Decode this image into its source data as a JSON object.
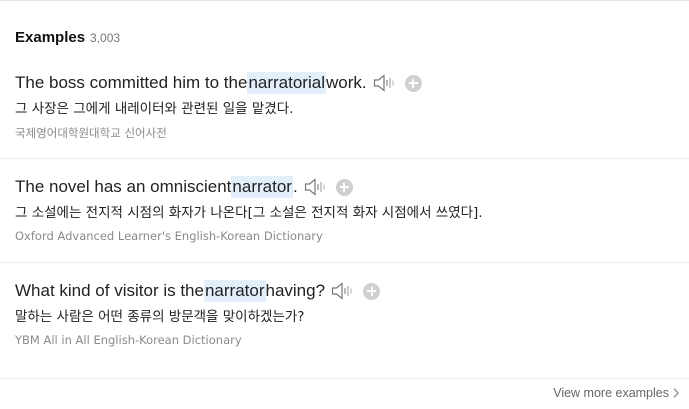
{
  "section": {
    "title": "Examples",
    "count": "3,003"
  },
  "examples": [
    {
      "before": "The boss committed him to the ",
      "highlight": "narratorial",
      "after": " work.",
      "translation": "그 사장은 그에게 내레이터와 관련된 일을 맡겼다.",
      "source": "국제영어대학원대학교 신어사전"
    },
    {
      "before": "The novel has an omniscient ",
      "highlight": "narrator",
      "after": ".",
      "translation": "그 소설에는 전지적 시점의 화자가 나온다[그 소설은 전지적 화자 시점에서 쓰였다].",
      "source": "Oxford Advanced Learner's English-Korean Dictionary"
    },
    {
      "before": "What kind of visitor is the ",
      "highlight": "narrator",
      "after": " having?",
      "translation": "말하는 사람은 어떤 종류의 방문객을 맞이하겠는가?",
      "source": "YBM All in All English-Korean Dictionary"
    }
  ],
  "footer": {
    "view_more": "View more examples"
  },
  "icons": {
    "speaker": "speaker-icon",
    "add": "plus-circle-icon",
    "chevron": "chevron-right-icon"
  },
  "colors": {
    "highlight_bg": "#e3f0fc",
    "muted_text": "#8a8a8a",
    "icon_gray": "#d0d0d0"
  }
}
